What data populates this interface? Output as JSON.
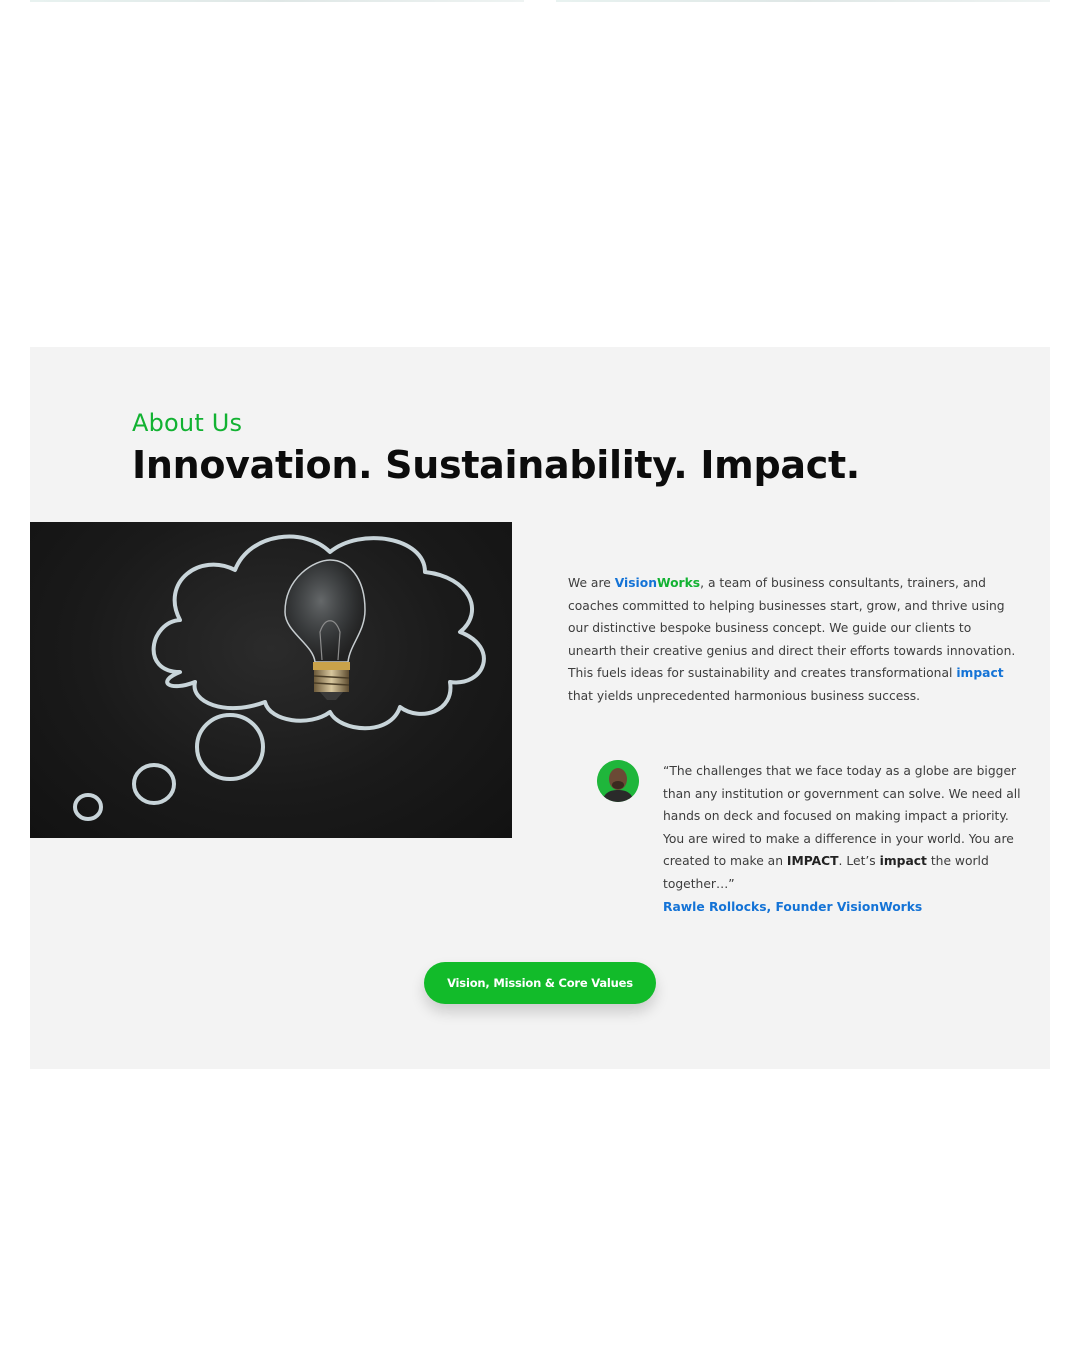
{
  "colors": {
    "accent_green": "#12b232",
    "accent_blue": "#1473d6",
    "section_background": "#f3f3f3",
    "button_background": "#12bb2a",
    "headline_text": "#0c0c0c",
    "body_text": "#3d3d3d"
  },
  "about": {
    "eyebrow": "About Us",
    "headline": "Innovation. Sustainability. Impact.",
    "image_icon": "lightbulb-thought-cloud-image",
    "intro": {
      "p1": "We are ",
      "brand_part1": "Vision",
      "brand_part2": "Works",
      "p2": ", a team of business consultants, trainers, and coaches committed to helping businesses start, grow, and thrive using our distinctive bespoke business concept. We guide our clients to unearth their creative genius and direct their efforts towards innovation. This fuels ideas for sustainability and creates transformational ",
      "highlight": "impact",
      "p3": " that yields unprecedented harmonious business success."
    },
    "quote": {
      "avatar_icon": "founder-portrait",
      "q1": "“The challenges that we face today as a globe are bigger than any institution or government can solve. We need all hands on deck and focused on making impact a priority. You are wired to make a difference in your world. You are created to make an ",
      "b1": "IMPACT",
      "q2": ". Let’s ",
      "b2": "impact",
      "q3": " the world together…”",
      "attribution": "Rawle Rollocks, Founder VisionWorks"
    },
    "cta_label": "Vision, Mission & Core Values"
  }
}
